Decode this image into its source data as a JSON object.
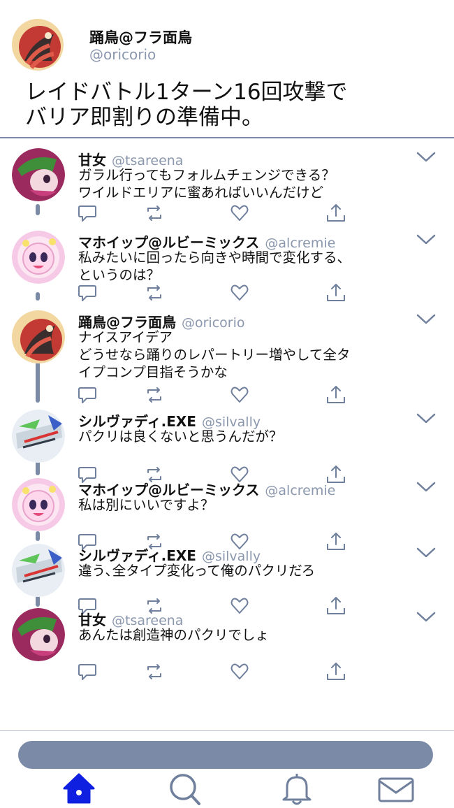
{
  "main_post": {
    "name": "踊鳥@フラ面鳥",
    "handle": "@oricorio",
    "text": "レイドバトル1ターン16回攻撃で\nバリア即割りの準備中。",
    "avatar_icon": "oricorio-avatar-icon"
  },
  "replies": [
    {
      "name": "甘女",
      "handle": "@tsareena",
      "text": "ガラル行ってもフォルムチェンジできる？\nワイルドエリアに蜜あればいいんだけど",
      "avatar_icon": "tsareena-avatar-icon"
    },
    {
      "name": "マホイップ@ルビーミックス",
      "handle": "@alcremie",
      "text": "私みたいに回ったら向きや時間で変化する、\nというのは？",
      "avatar_icon": "alcremie-avatar-icon"
    },
    {
      "name": "踊鳥@フラ面鳥",
      "handle": "@oricorio",
      "text": "ナイスアイデア\nどうせなら踊りのレパートリー増やして全タ\nイプコンプ目指そうかな",
      "avatar_icon": "oricorio-avatar-icon"
    },
    {
      "name": "シルヴァディ.EXE",
      "handle": "@silvally",
      "text": "パクリは良くないと思うんだが？",
      "avatar_icon": "silvally-avatar-icon"
    },
    {
      "name": "マホイップ@ルビーミックス",
      "handle": "@alcremie",
      "text": "私は別にいいですよ？",
      "avatar_icon": "alcremie-avatar-icon"
    },
    {
      "name": "シルヴァディ.EXE",
      "handle": "@silvally",
      "text": "違う､全タイプ変化って俺のパクリだろ",
      "avatar_icon": "silvally-avatar-icon"
    },
    {
      "name": "甘女",
      "handle": "@tsareena",
      "text": "あんたは創造神のパクリでしょ",
      "avatar_icon": "tsareena-avatar-icon"
    }
  ],
  "action_icons": [
    "reply-icon",
    "retweet-icon",
    "like-icon",
    "share-icon"
  ],
  "nav": {
    "tabs": [
      {
        "icon": "home-icon",
        "active": true
      },
      {
        "icon": "search-icon",
        "active": false
      },
      {
        "icon": "notifications-icon",
        "active": false
      },
      {
        "icon": "messages-icon",
        "active": false
      }
    ]
  },
  "colors": {
    "accent": "#7b8aa6",
    "active_tab": "#1020e0",
    "handle_text": "#8a97ad"
  }
}
